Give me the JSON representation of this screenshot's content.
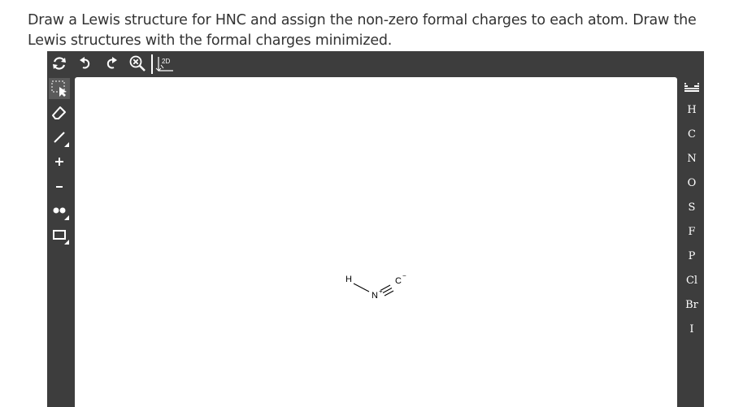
{
  "question": {
    "text": "Draw a Lewis structure for HNC and assign the non-zero formal charges to each atom.  Draw the Lewis structures with the formal charges minimized."
  },
  "editor": {
    "top_toolbar": {
      "buttons": [
        {
          "name": "clear-canvas-icon"
        },
        {
          "name": "undo-icon"
        },
        {
          "name": "redo-icon"
        },
        {
          "name": "zoom-icon"
        }
      ],
      "mode_label": "2D"
    },
    "left_toolbar": {
      "tools": [
        {
          "name": "select-tool-icon",
          "active": true
        },
        {
          "name": "eraser-icon"
        },
        {
          "name": "bond-tool-icon"
        },
        {
          "name": "positive-charge-icon"
        },
        {
          "name": "negative-charge-icon"
        },
        {
          "name": "lone-pair-icon"
        },
        {
          "name": "shape-tool-icon"
        }
      ]
    },
    "elements": [
      "H",
      "C",
      "N",
      "O",
      "S",
      "F",
      "P",
      "Cl",
      "Br",
      "I"
    ],
    "molecule": {
      "atoms": [
        {
          "symbol": "H",
          "charge": ""
        },
        {
          "symbol": "N",
          "charge": "+"
        },
        {
          "symbol": "C",
          "charge": "−"
        }
      ],
      "bonds": [
        {
          "from": "H",
          "to": "N",
          "order": 1
        },
        {
          "from": "N",
          "to": "C",
          "order": 3
        }
      ]
    },
    "colors": {
      "toolbar": "#3d3d3d",
      "icon": "#ffffff",
      "canvas": "#ffffff"
    }
  }
}
